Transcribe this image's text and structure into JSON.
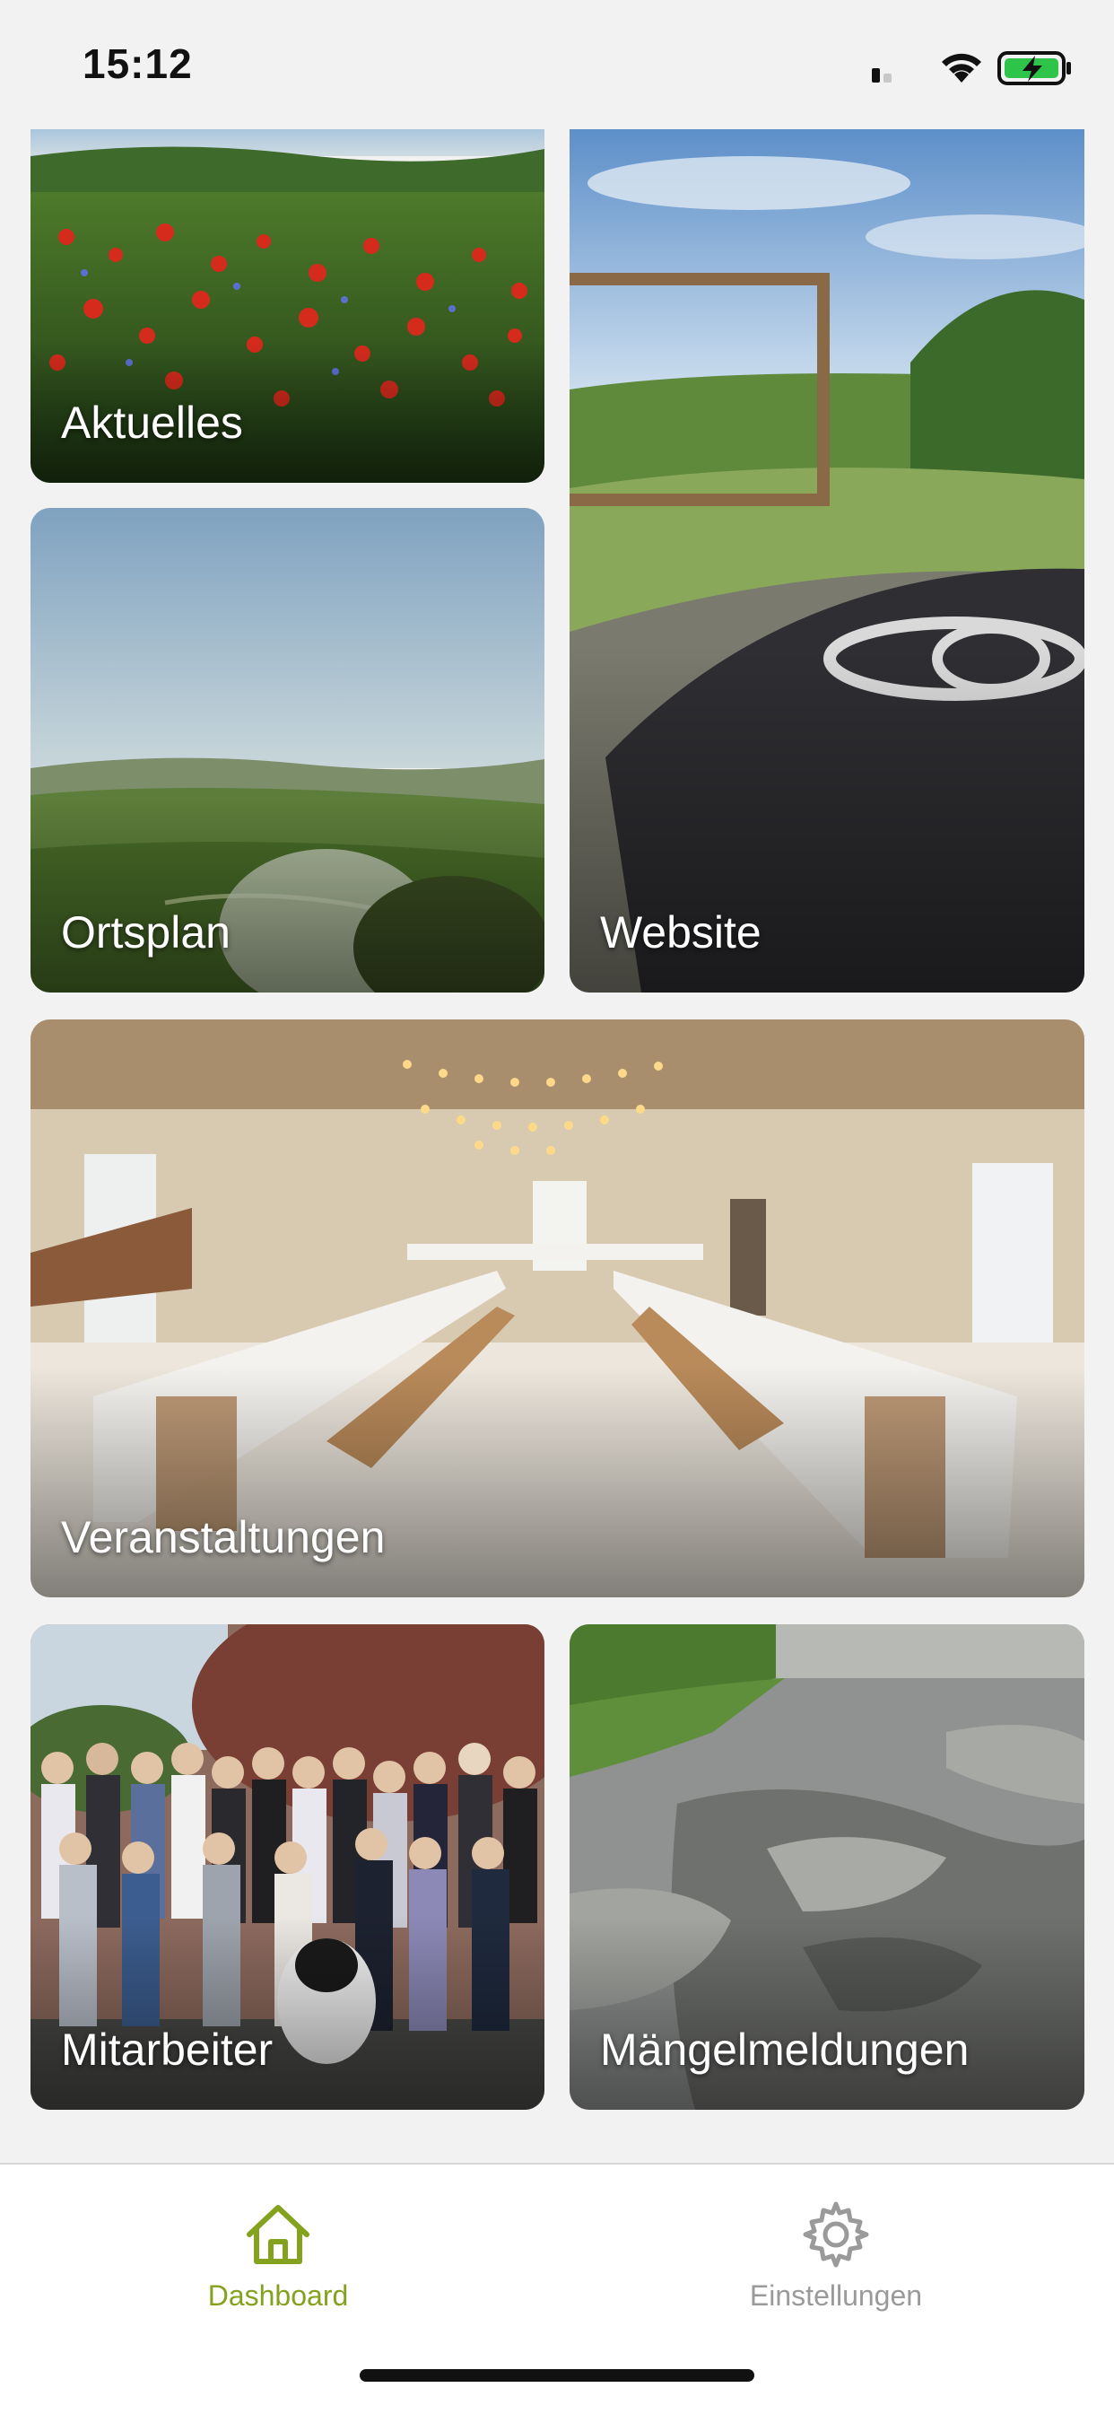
{
  "status_bar": {
    "time": "15:12",
    "icons": [
      "cellular-signal-icon",
      "wifi-icon",
      "battery-charging-icon"
    ]
  },
  "tiles": [
    {
      "label": "Aktuelles"
    },
    {
      "label": "Website"
    },
    {
      "label": "Ortsplan"
    },
    {
      "label": "Veranstaltungen"
    },
    {
      "label": "Mitarbeiter"
    },
    {
      "label": "Mängelmeldungen"
    }
  ],
  "tab_bar": {
    "items": [
      {
        "label": "Dashboard",
        "icon": "home-icon",
        "active": true
      },
      {
        "label": "Einstellungen",
        "icon": "gear-icon",
        "active": false
      }
    ]
  },
  "colors": {
    "accent": "#84a21e",
    "inactive": "#9a9a9a",
    "battery": "#2ec44a",
    "background": "#f2f2f2"
  }
}
